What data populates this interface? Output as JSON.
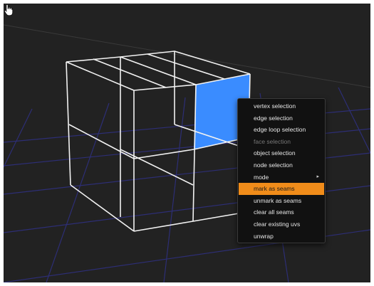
{
  "viewport": {
    "background_color": "#222222",
    "grid_color": "#2e2f7a",
    "wireframe_color": "#f2f2f2",
    "selected_face_color": "#3a8cff"
  },
  "context_menu": {
    "items": [
      {
        "label": "vertex selection",
        "state": "normal"
      },
      {
        "label": "edge selection",
        "state": "normal"
      },
      {
        "label": "edge loop selection",
        "state": "normal"
      },
      {
        "label": "face selection",
        "state": "disabled"
      },
      {
        "label": "object selection",
        "state": "normal"
      },
      {
        "label": "node selection",
        "state": "normal"
      },
      {
        "label": "mode",
        "state": "submenu",
        "arrow": "▸"
      },
      {
        "label": "mark as seams",
        "state": "highlighted"
      },
      {
        "label": "unmark as seams",
        "state": "normal"
      },
      {
        "label": "clear all seams",
        "state": "normal"
      },
      {
        "label": "clear existing uvs",
        "state": "normal"
      },
      {
        "label": "unwrap",
        "state": "normal"
      }
    ],
    "highlight_color": "#f08c1a"
  },
  "cursor": {
    "icon": "hand-pointer-icon"
  }
}
